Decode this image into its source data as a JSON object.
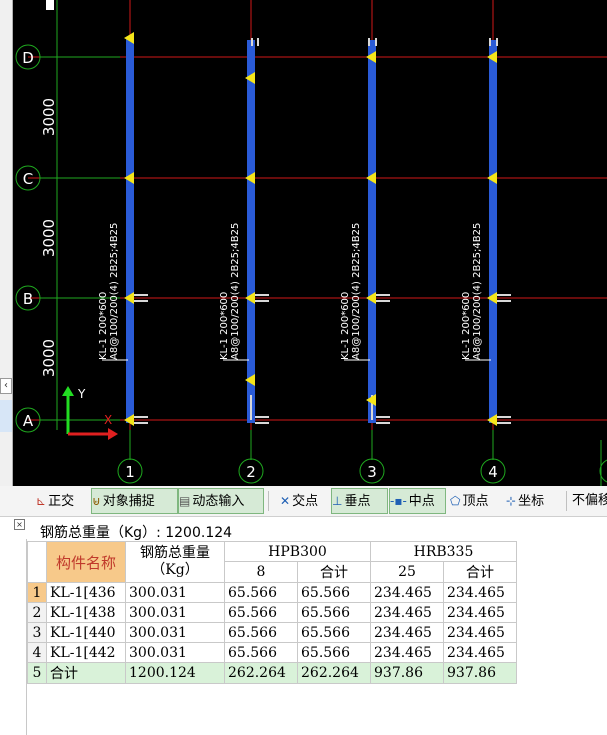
{
  "drawing": {
    "row_axes": [
      "D",
      "C",
      "B",
      "A"
    ],
    "col_axes": [
      "1",
      "2",
      "3",
      "4"
    ],
    "spans": [
      "3000",
      "3000",
      "3000"
    ],
    "beam_label_1": "KL-1 200*600",
    "beam_label_2": "A8@100/200(4) 2B25;4B25",
    "ucs_y": "Y",
    "ucs_x": "X"
  },
  "toolbar": {
    "ortho": "正交",
    "snap": "对象捕捉",
    "dynamic": "动态输入",
    "intersection": "交点",
    "perpendicular": "垂点",
    "midpoint": "中点",
    "vertex": "顶点",
    "coordinate": "坐标",
    "no_offset": "不偏移"
  },
  "panel": {
    "total_label": "钢筋总重量（Kg）: 1200.124",
    "headers": {
      "component": "构件名称",
      "total_weight": "钢筋总重量\n（Kg）",
      "hpb": "HPB300",
      "hrb": "HRB335",
      "d8": "8",
      "hpb_sum": "合计",
      "d25": "25",
      "hrb_sum": "合计"
    },
    "rows": [
      {
        "n": "1",
        "name": "KL-1[436",
        "total": "300.031",
        "h8": "65.566",
        "hsum": "65.566",
        "r25": "234.465",
        "rsum": "234.465"
      },
      {
        "n": "2",
        "name": "KL-1[438",
        "total": "300.031",
        "h8": "65.566",
        "hsum": "65.566",
        "r25": "234.465",
        "rsum": "234.465"
      },
      {
        "n": "3",
        "name": "KL-1[440",
        "total": "300.031",
        "h8": "65.566",
        "hsum": "65.566",
        "r25": "234.465",
        "rsum": "234.465"
      },
      {
        "n": "4",
        "name": "KL-1[442",
        "total": "300.031",
        "h8": "65.566",
        "hsum": "65.566",
        "r25": "234.465",
        "rsum": "234.465"
      },
      {
        "n": "5",
        "name": "合计",
        "total": "1200.124",
        "h8": "262.264",
        "hsum": "262.264",
        "r25": "937.86",
        "rsum": "937.86"
      }
    ]
  }
}
